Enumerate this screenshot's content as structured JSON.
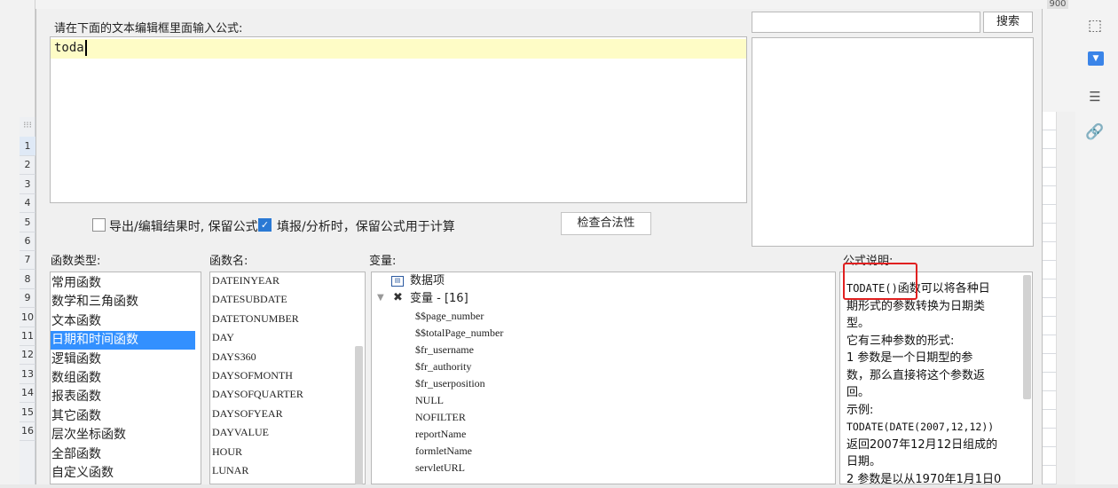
{
  "prompt": "请在下面的文本编辑框里面输入公式:",
  "editor": {
    "value": "toda"
  },
  "search": {
    "value": "",
    "button_label": "搜索"
  },
  "options": {
    "export_keep_formula": {
      "label": "导出/编辑结果时, 保留公式",
      "checked": false
    },
    "fill_keep_formula": {
      "label": "填报/分析时，保留公式用于计算",
      "checked": true
    },
    "validate_label": "检查合法性"
  },
  "sections": {
    "function_types": "函数类型:",
    "function_names": "函数名:",
    "variables": "变量:",
    "description": "公式说明:"
  },
  "function_types": [
    "常用函数",
    "数学和三角函数",
    "文本函数",
    "日期和时间函数",
    "逻辑函数",
    "数组函数",
    "报表函数",
    "其它函数",
    "层次坐标函数",
    "全部函数",
    "自定义函数"
  ],
  "selected_type": "日期和时间函数",
  "function_names": [
    "DATEINYEAR",
    "DATESUBDATE",
    "DATETONUMBER",
    "DAY",
    "DAYS360",
    "DAYSOFMONTH",
    "DAYSOFQUARTER",
    "DAYSOFYEAR",
    "DAYVALUE",
    "HOUR",
    "LUNAR"
  ],
  "variables": {
    "data_item": "数据项",
    "variable_group": "变量 - [16]",
    "items": [
      "$$page_number",
      "$$totalPage_number",
      "$fr_username",
      "$fr_authority",
      "$fr_userposition",
      "NULL",
      "NOFILTER",
      "reportName",
      "formletName",
      "servletURL"
    ]
  },
  "description": {
    "func": "TODATE()",
    "lines": [
      "函数可以将各种日",
      "期形式的参数转换为日期类",
      "型。",
      "它有三种参数的形式:",
      "1 参数是一个日期型的参",
      "数，那么直接将这个参数返",
      "回。",
      "示例:",
      "TODATE(DATE(2007,12,12))",
      "返回2007年12月12日组成的",
      "日期。",
      "2 参数是以从1970年1月1日0"
    ]
  },
  "row_numbers": [
    "1",
    "2",
    "3",
    "4",
    "5",
    "6",
    "7",
    "8",
    "9",
    "10",
    "11",
    "12",
    "13",
    "14",
    "15",
    "16"
  ],
  "ruler_value": "900",
  "colors": {
    "selection": "#3390ff",
    "editor_highlight": "#fefcc6",
    "annotation": "#e02020"
  }
}
